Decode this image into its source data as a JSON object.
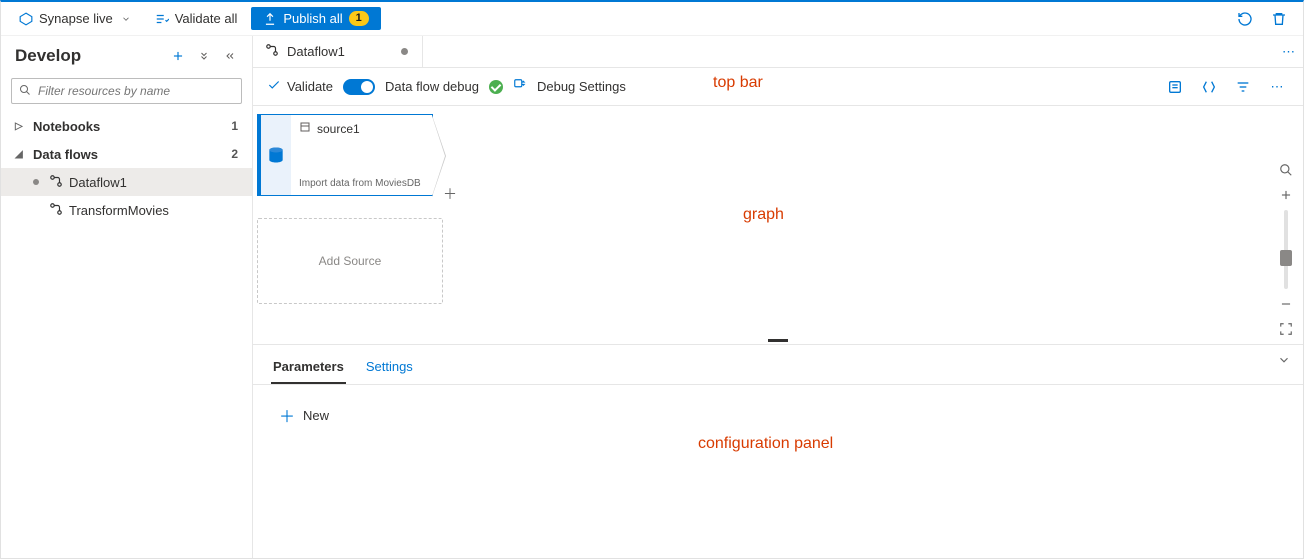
{
  "cmdbar": {
    "workspace": "Synapse live",
    "validate_all": "Validate all",
    "publish_all": "Publish all",
    "publish_badge": "1"
  },
  "sidebar": {
    "title": "Develop",
    "filter_placeholder": "Filter resources by name",
    "sections": [
      {
        "label": "Notebooks",
        "count": "1",
        "expanded": false
      },
      {
        "label": "Data flows",
        "count": "2",
        "expanded": true
      }
    ],
    "dataflows": [
      {
        "label": "Dataflow1",
        "dirty": true,
        "selected": true
      },
      {
        "label": "TransformMovies",
        "dirty": false,
        "selected": false
      }
    ]
  },
  "tab": {
    "label": "Dataflow1"
  },
  "toolbar": {
    "validate": "Validate",
    "debug_label": "Data flow debug",
    "debug_settings": "Debug Settings"
  },
  "graph": {
    "node_title": "source1",
    "node_desc": "Import data from MoviesDB",
    "add_source": "Add Source"
  },
  "config": {
    "tabs": [
      {
        "label": "Parameters",
        "active": true
      },
      {
        "label": "Settings",
        "active": false
      }
    ],
    "new_btn": "New"
  },
  "annotations": {
    "topbar": "top bar",
    "graph": "graph",
    "configpanel": "configuration panel"
  }
}
